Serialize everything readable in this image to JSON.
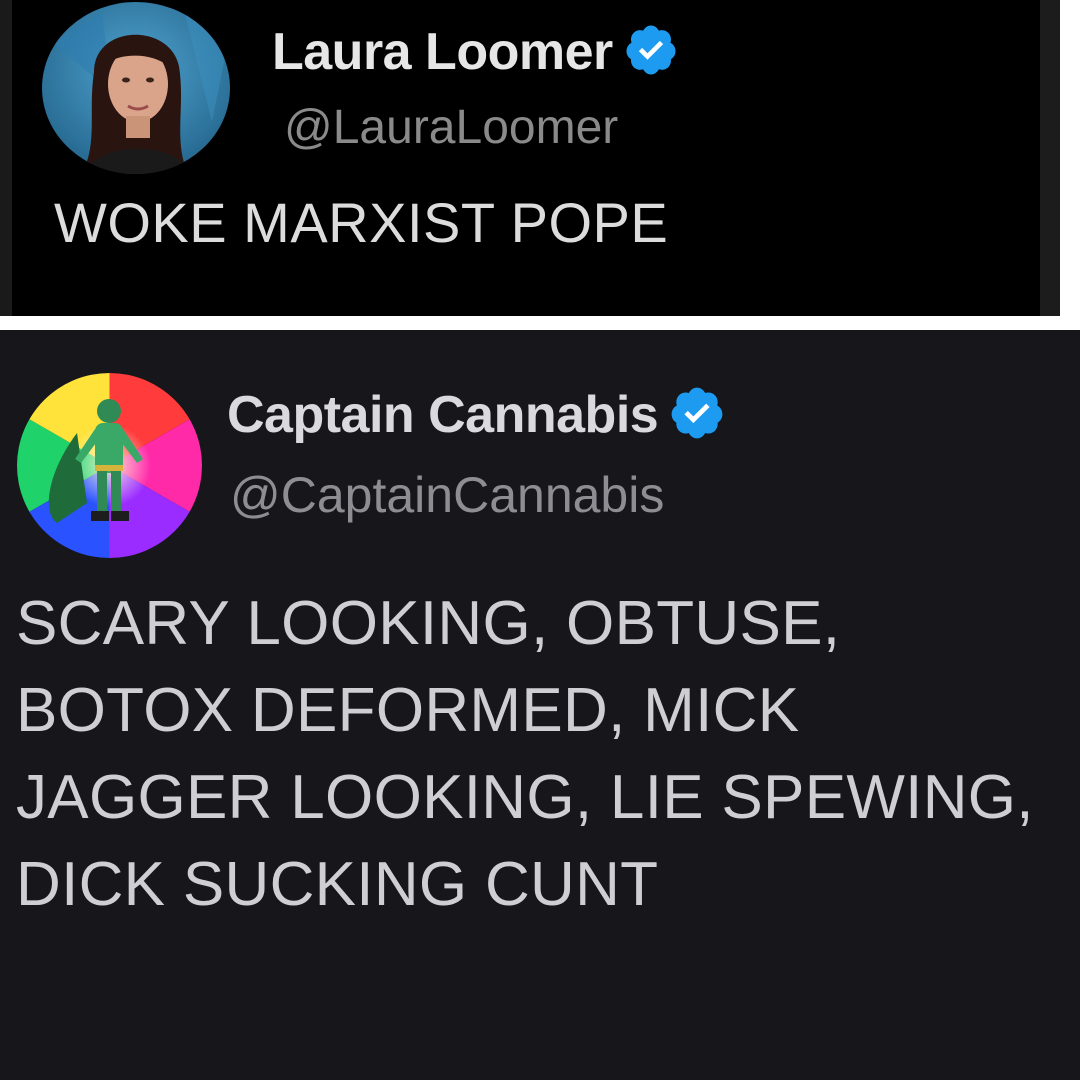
{
  "tweets": [
    {
      "display_name": "Laura Loomer",
      "handle": "@LauraLoomer",
      "verified": true,
      "text": "WOKE MARXIST POPE",
      "avatar_icon": "profile-photo-woman"
    },
    {
      "display_name": "Captain Cannabis",
      "handle": "@CaptainCannabis",
      "verified": true,
      "text": "SCARY LOOKING, OBTUSE, BOTOX DEFORMED, MICK JAGGER LOOKING, LIE SPEWING, DICK SUCKING CUNT",
      "avatar_icon": "superhero-rainbow-avatar"
    }
  ],
  "colors": {
    "top_background": "#000000",
    "bottom_background": "#16161b",
    "verified_blue": "#1d9bf0",
    "handle_gray": "#8a8a8a"
  }
}
